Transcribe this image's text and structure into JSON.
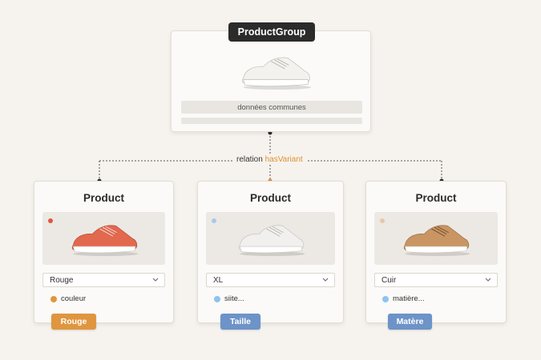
{
  "parent": {
    "badge": "ProductGroup",
    "shared_label": "données communes"
  },
  "relation": {
    "prefix": "relation",
    "name": "hasVariant",
    "accent_color": "#e08f35"
  },
  "children": [
    {
      "title": "Product",
      "shoe_color": "#e2684e",
      "dot_color": "#e0573e",
      "select_value": "Rouge",
      "property_label": "couleur",
      "property_dot_color": "#e0963f",
      "tag": "Rouge",
      "tag_color": "#e0963f"
    },
    {
      "title": "Product",
      "shoe_color": "#f1f0ee",
      "dot_color": "#a9c8ee",
      "select_value": "XL",
      "property_label": "siite...",
      "property_dot_color": "#8cc3f2",
      "tag": "Taille",
      "tag_color": "#6d93c8"
    },
    {
      "title": "Product",
      "shoe_color": "#c89563",
      "dot_color": "#e8c7a7",
      "select_value": "Cuir",
      "property_label": "matière...",
      "property_dot_color": "#8cc3f2",
      "tag": "Matère",
      "tag_color": "#6d93c8"
    }
  ],
  "icons": [
    "shoe-image",
    "chevron-down-icon"
  ]
}
